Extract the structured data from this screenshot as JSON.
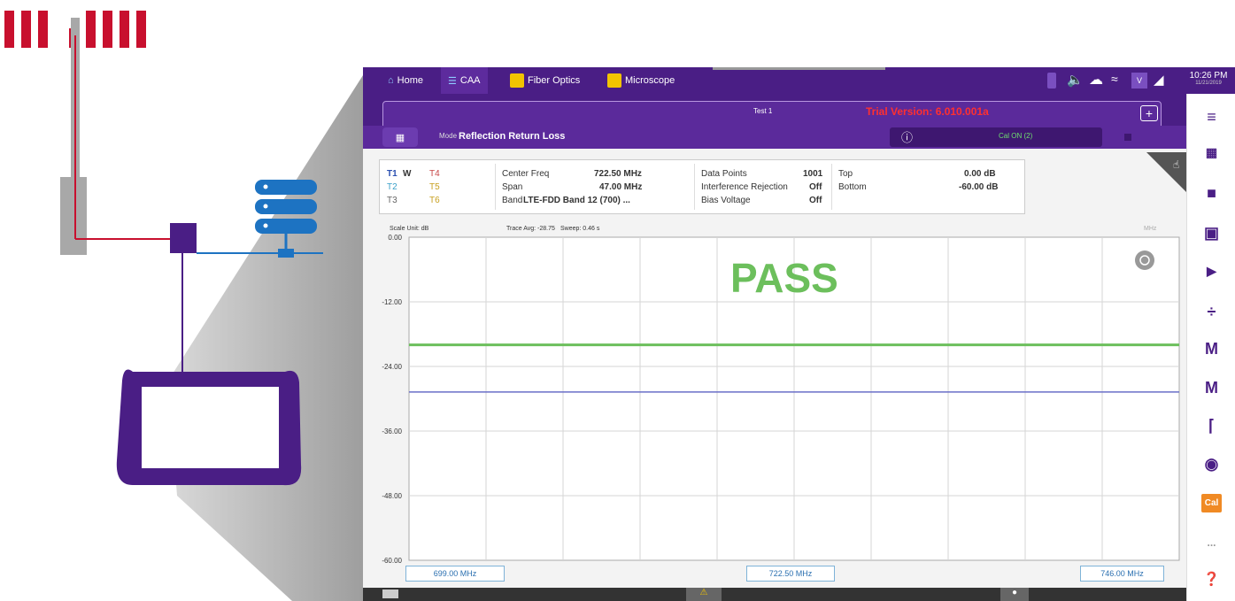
{
  "illustration": {
    "logo": "brand-logo-bars",
    "antenna": "antenna-tower",
    "server": "server-stack-icon",
    "device": "handheld-tester"
  },
  "topbar": {
    "tabs": [
      {
        "label": "Home",
        "icon": "home-icon"
      },
      {
        "label": "CAA",
        "icon": "caa-icon"
      },
      {
        "label": "Fiber Optics",
        "icon": "fiber-optics-icon"
      },
      {
        "label": "Microscope",
        "icon": "microscope-icon"
      }
    ],
    "clock_time": "10:26 PM",
    "clock_date": "11/21/2019"
  },
  "header": {
    "test_label": "Test 1",
    "version_text": "Trial Version: 6.010.001a",
    "mode_label": "Mode",
    "mode_value": "Reflection Return Loss",
    "cal_status": "Cal ON (2)"
  },
  "traces": {
    "t1": "T1",
    "w": "W",
    "t4": "T4",
    "t2": "T2",
    "t5": "T5",
    "t3": "T3",
    "t6": "T6"
  },
  "params": {
    "center_freq_label": "Center Freq",
    "center_freq_value": "722.50 MHz",
    "span_label": "Span",
    "span_value": "47.00 MHz",
    "band_label": "Band",
    "band_value": "LTE-FDD Band 12 (700) ...",
    "data_points_label": "Data Points",
    "data_points_value": "1001",
    "interference_label": "Interference Rejection",
    "interference_value": "Off",
    "bias_label": "Bias Voltage",
    "bias_value": "Off",
    "top_label": "Top",
    "top_value": "0.00 dB",
    "bottom_label": "Bottom",
    "bottom_value": "-60.00 dB"
  },
  "chart_info": {
    "scale_unit": "Scale Unit: dB",
    "trace_avg": "Trace Avg: -28.75",
    "sweep": "Sweep: 0.46 s",
    "unit_right": "MHz",
    "pass_text": "PASS"
  },
  "chart_data": {
    "type": "line",
    "yticks": [
      "0.00",
      "-12.00",
      "-24.00",
      "-36.00",
      "-48.00",
      "-60.00"
    ],
    "ylim": [
      -60,
      0
    ],
    "xlim": [
      699.0,
      746.0
    ],
    "limit_line": -20,
    "trace": {
      "x": [
        699.0,
        746.0
      ],
      "y": [
        -28.75,
        -28.75
      ]
    },
    "xlabels": [
      "699.00 MHz",
      "722.50 MHz",
      "746.00 MHz"
    ],
    "grid": true,
    "colors": {
      "limit": "#6cbf5c",
      "trace": "#6a6fc8",
      "pass": "#6cbf5c"
    }
  },
  "rightbar": {
    "items": [
      "menu-icon",
      "layout-icon",
      "lock-icon",
      "save-icon",
      "folder-icon",
      "divide-icon",
      "marker-icon",
      "marker-list-icon",
      "peak-icon",
      "camera-icon",
      "cal-button",
      "more-icon",
      "help-icon"
    ],
    "cal_label": "Cal",
    "more_label": "..."
  },
  "colors": {
    "accent": "#4a1e85",
    "brand": "#c8102e",
    "version": "#ff3030"
  }
}
